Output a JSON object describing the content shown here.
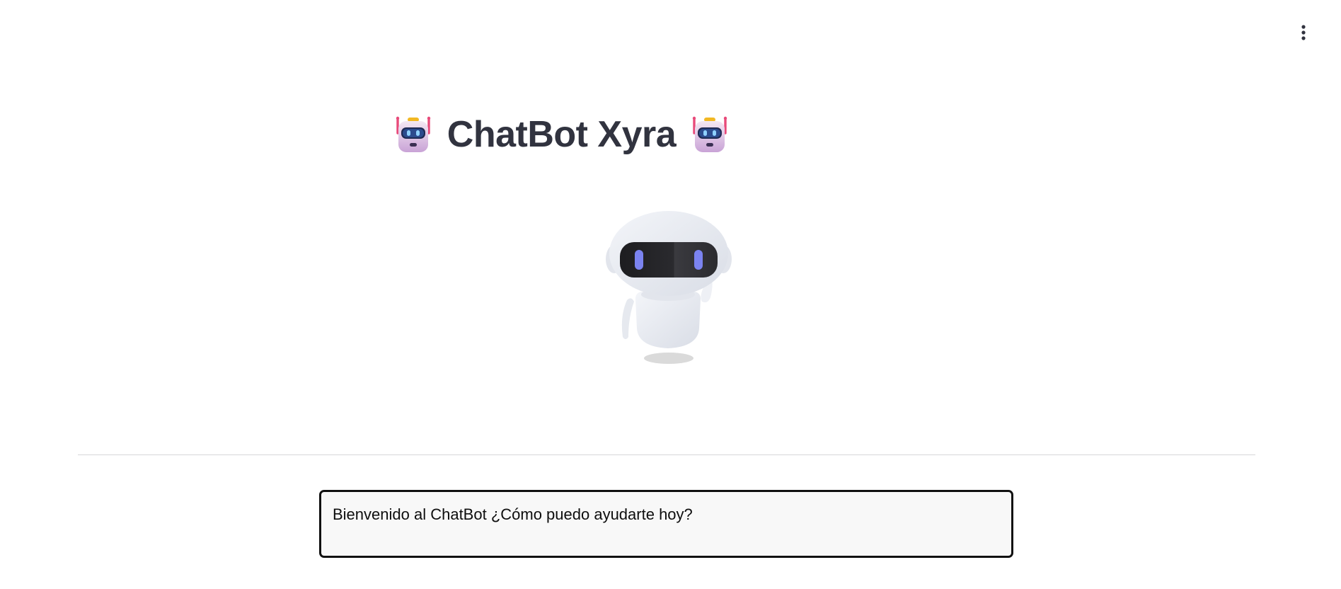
{
  "header": {
    "title": "ChatBot Xyra",
    "title_icon_left": "robot-face-icon",
    "title_icon_right": "robot-face-icon"
  },
  "toolbar": {
    "menu_icon": "vertical-ellipsis-icon"
  },
  "hero": {
    "illustration": "robot-mascot-icon"
  },
  "chat": {
    "welcome_message": "Bienvenido al ChatBot ¿Cómo puedo ayudarte hoy?"
  },
  "colors": {
    "background": "#ffffff",
    "title_text": "#31333f",
    "divider": "#d6d6d9",
    "message_border": "#111111",
    "message_background": "#f8f8f8",
    "robot_eye": "#7b83f0",
    "robot_visor": "#2b2b2f",
    "emoji_antenna": "#e84a7a"
  }
}
